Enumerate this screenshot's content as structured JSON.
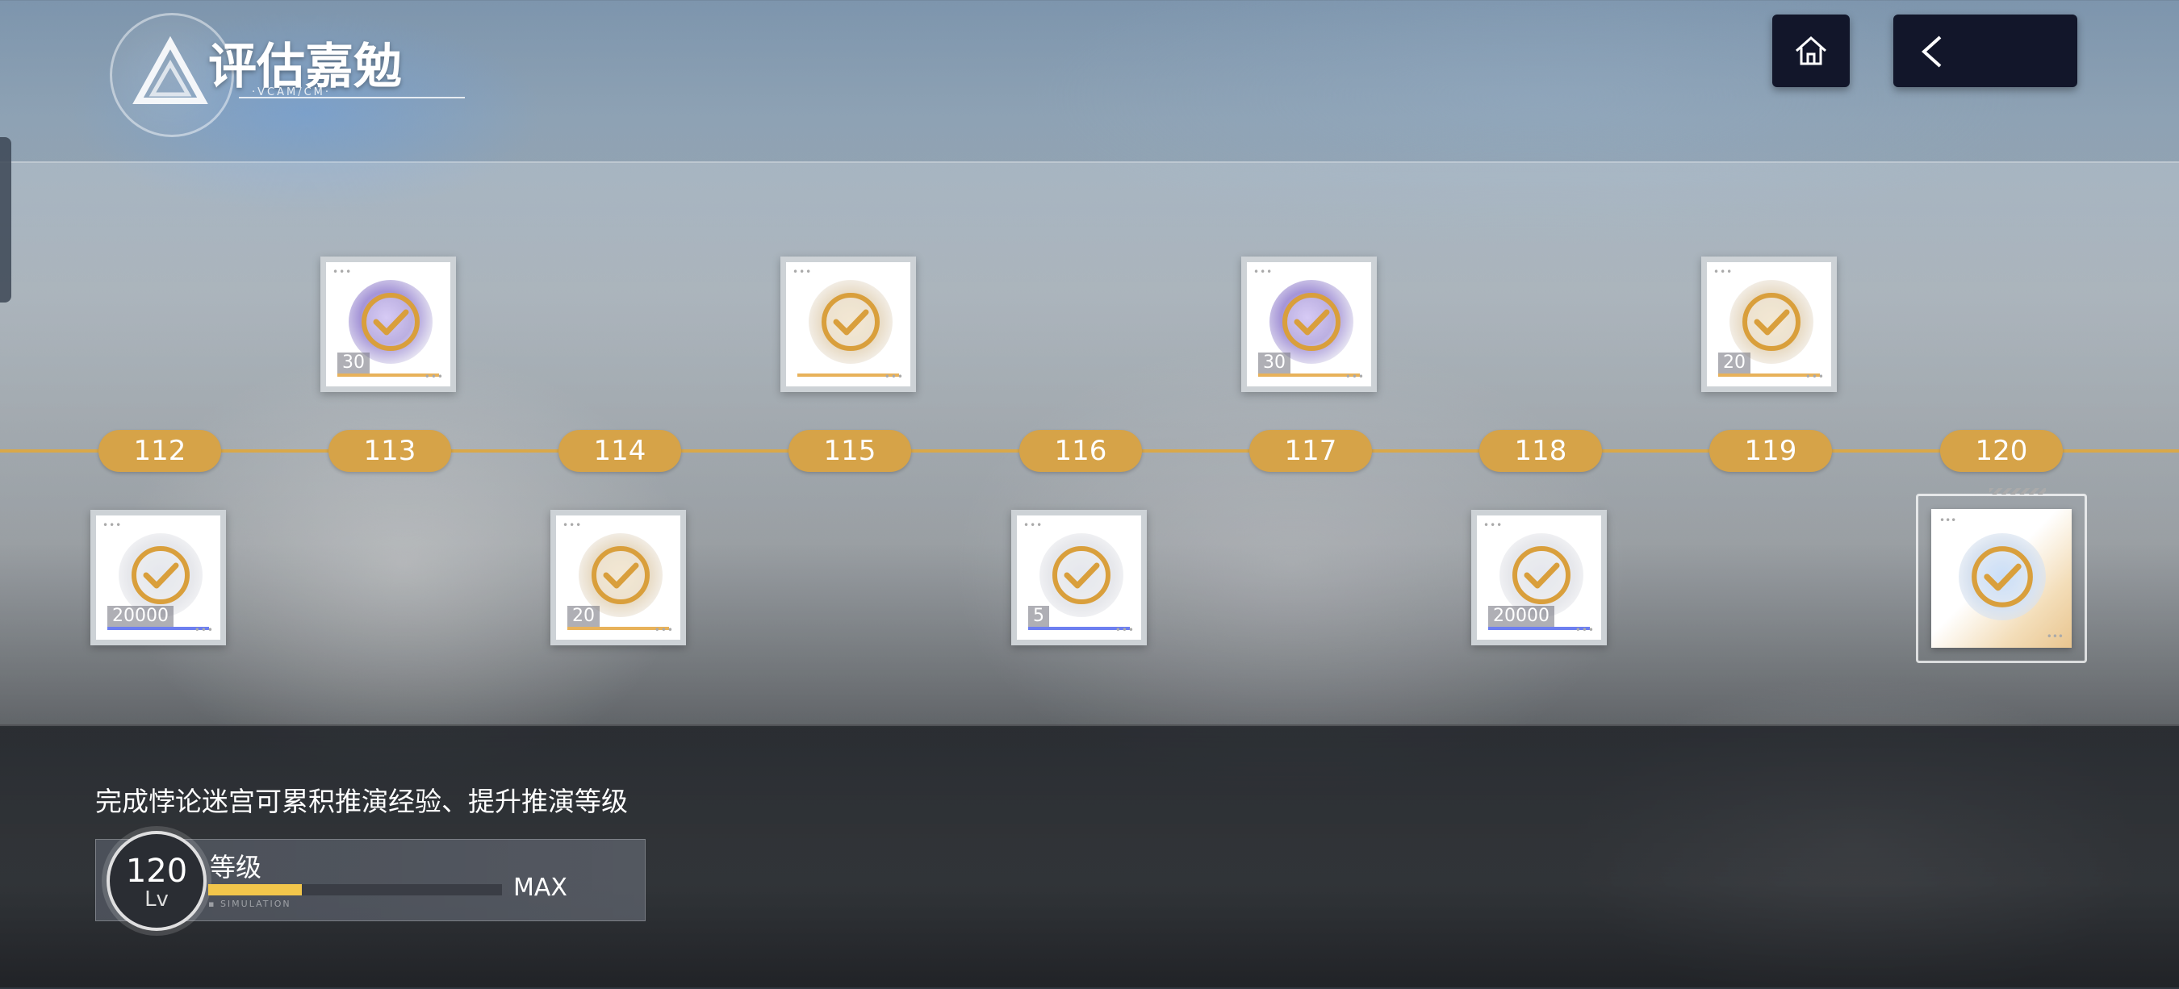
{
  "header": {
    "title": "评估嘉勉",
    "subtitle": "·VCAM/CM·"
  },
  "nav": {
    "home_icon": "home-icon",
    "back_icon": "chevron-left-icon"
  },
  "track": {
    "levels": [
      "112",
      "113",
      "114",
      "115",
      "116",
      "117",
      "118",
      "119",
      "120"
    ],
    "accent": "#d6a348"
  },
  "rewards": [
    {
      "level": "112",
      "qty": "20000",
      "art": "gray",
      "bar": "blue",
      "claimed": true
    },
    {
      "level": "113",
      "qty": "30",
      "art": "purple",
      "bar": "gold",
      "claimed": true
    },
    {
      "level": "114",
      "qty": "20",
      "art": "gold",
      "bar": "gold",
      "claimed": true
    },
    {
      "level": "115",
      "qty": "",
      "art": "gold",
      "bar": "gold",
      "claimed": true
    },
    {
      "level": "116",
      "qty": "5",
      "art": "gray",
      "bar": "blue",
      "claimed": true
    },
    {
      "level": "117",
      "qty": "30",
      "art": "purple",
      "bar": "gold",
      "claimed": true
    },
    {
      "level": "118",
      "qty": "20000",
      "art": "gray",
      "bar": "blue",
      "claimed": true
    },
    {
      "level": "119",
      "qty": "20",
      "art": "gold",
      "bar": "gold",
      "claimed": true
    },
    {
      "level": "120",
      "qty": "",
      "art": "blue",
      "bar": "none",
      "claimed": true
    }
  ],
  "info": {
    "hint": "完成悖论迷宫可累积推演经验、提升推演等级",
    "level_value": "120",
    "level_unit": "Lv",
    "level_label": "等级",
    "exp_fraction": 0.32,
    "max_label": "MAX",
    "exp_sub": "▪ SIMULATION"
  }
}
